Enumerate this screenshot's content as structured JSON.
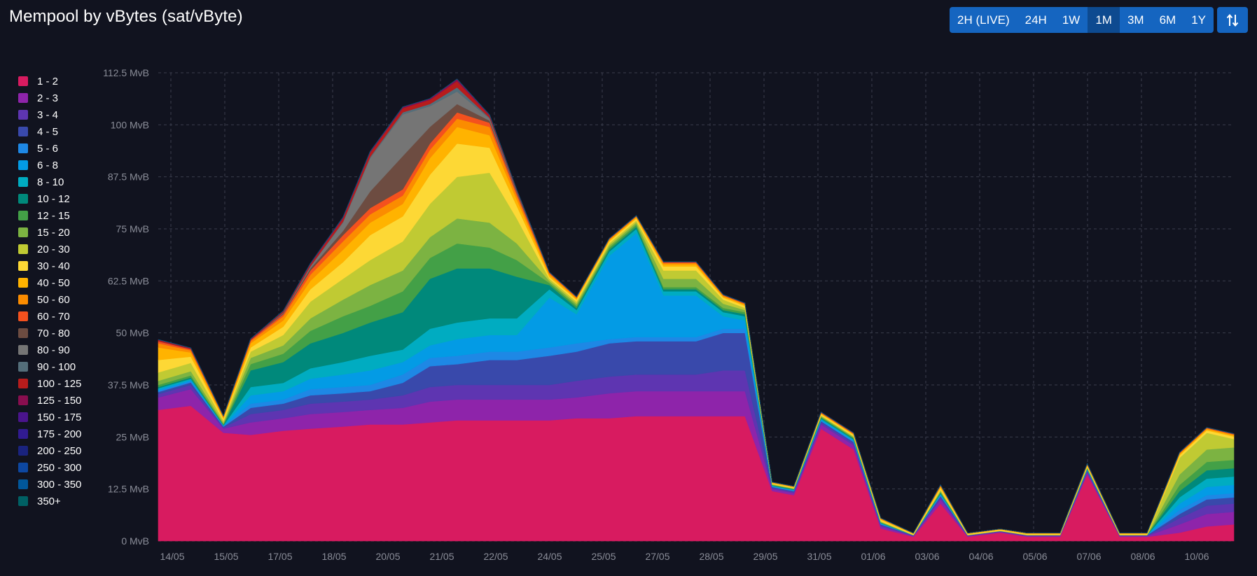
{
  "header": {
    "title": "Mempool by vBytes (sat/vByte)",
    "ranges": [
      "2H (LIVE)",
      "24H",
      "1W",
      "1M",
      "3M",
      "6M",
      "1Y"
    ],
    "active_range": "1M",
    "toggle_icon": "sort-arrows-icon"
  },
  "colors": {
    "background": "#11131f",
    "button": "#1565c0",
    "button_active": "#0d4a90",
    "grid": "#3a3d4c",
    "axis_text": "#8a8d98"
  },
  "chart_data": {
    "type": "area",
    "stacked": true,
    "title": "Mempool by vBytes (sat/vByte)",
    "ylabel_unit": "MvB",
    "ylim": [
      0,
      112.5
    ],
    "yticks": [
      "0 MvB",
      "12.5 MvB",
      "25 MvB",
      "37.5 MvB",
      "50 MvB",
      "62.5 MvB",
      "75 MvB",
      "87.5 MvB",
      "100 MvB",
      "112.5 MvB"
    ],
    "xlim": [
      0,
      30
    ],
    "xticks": [
      {
        "x": 0,
        "label": "14/05"
      },
      {
        "x": 1,
        "label": "15/05"
      },
      {
        "x": 2,
        "label": "17/05"
      },
      {
        "x": 3,
        "label": "18/05"
      },
      {
        "x": 4,
        "label": "20/05"
      },
      {
        "x": 5,
        "label": "21/05"
      },
      {
        "x": 6,
        "label": "22/05"
      },
      {
        "x": 7,
        "label": "24/05"
      },
      {
        "x": 8,
        "label": "25/05"
      },
      {
        "x": 9,
        "label": "27/05"
      },
      {
        "x": 10,
        "label": "28/05"
      },
      {
        "x": 11,
        "label": "29/05"
      },
      {
        "x": 12,
        "label": "31/05"
      },
      {
        "x": 13,
        "label": "01/06"
      },
      {
        "x": 14,
        "label": "03/06"
      },
      {
        "x": 15,
        "label": "04/06"
      },
      {
        "x": 16,
        "label": "05/06"
      },
      {
        "x": 17,
        "label": "07/06"
      },
      {
        "x": 18,
        "label": "08/06"
      },
      {
        "x": 19,
        "label": "10/06"
      }
    ],
    "x": [
      0,
      0.6,
      1.2,
      1.7,
      2.3,
      2.8,
      3.4,
      3.9,
      4.5,
      5.0,
      5.5,
      6.1,
      6.6,
      7.2,
      7.7,
      8.3,
      8.8,
      9.3,
      9.9,
      10.4,
      10.8,
      11.3,
      11.7,
      12.2,
      12.8,
      13.3,
      13.9,
      14.4,
      14.9,
      15.5,
      16.0,
      16.6,
      17.1,
      17.7,
      18.2,
      18.8,
      19.3,
      19.8
    ],
    "series": [
      {
        "name": "1 - 2",
        "color": "#d81b60",
        "values": [
          31.5,
          32.5,
          26,
          25.5,
          26.5,
          27,
          27.5,
          28,
          28,
          28.5,
          29,
          29,
          29,
          29,
          29.5,
          29.5,
          30,
          30,
          30,
          30,
          30,
          12,
          11,
          27,
          22,
          3,
          1,
          9,
          1,
          2,
          1,
          1,
          16,
          1,
          1,
          2,
          3.5,
          4
        ]
      },
      {
        "name": "2 - 3",
        "color": "#8e24aa",
        "values": [
          3,
          4,
          1,
          3,
          3,
          3.5,
          3.5,
          3.5,
          4,
          5,
          5,
          5,
          5,
          5,
          5,
          6,
          6,
          6,
          6,
          6,
          6,
          0.5,
          0.5,
          1,
          1,
          0.5,
          0.2,
          1,
          0.2,
          0.2,
          0.2,
          0.2,
          0.5,
          0.2,
          0.2,
          2,
          3,
          3
        ]
      },
      {
        "name": "3 - 4",
        "color": "#5e35b1",
        "values": [
          0.8,
          1,
          0.3,
          2,
          2,
          2.5,
          2.5,
          2.5,
          3,
          3.5,
          3.5,
          3.5,
          3.5,
          3.5,
          4,
          4,
          4,
          4,
          4,
          5,
          5,
          0.3,
          0.3,
          0.5,
          0.5,
          0.3,
          0.1,
          0.5,
          0.1,
          0.1,
          0.1,
          0.1,
          0.3,
          0.1,
          0.1,
          1.5,
          2,
          2
        ]
      },
      {
        "name": "4 - 5",
        "color": "#3949ab",
        "values": [
          0.5,
          0.6,
          0.2,
          1.5,
          1.5,
          2,
          2,
          2,
          3,
          5,
          5,
          6,
          6,
          7,
          7,
          8,
          8,
          8,
          8,
          9,
          9,
          0.2,
          0.2,
          0.3,
          0.3,
          0.2,
          0.1,
          0.3,
          0.1,
          0.1,
          0.1,
          0.1,
          0.2,
          0.1,
          0.1,
          1,
          1.5,
          1.5
        ]
      },
      {
        "name": "5 - 6",
        "color": "#1e88e5",
        "values": [
          0.3,
          0.3,
          0.1,
          1,
          1,
          1.5,
          1.5,
          1.5,
          2,
          2,
          2,
          2,
          2,
          2,
          2,
          1,
          1,
          1,
          1,
          1,
          1,
          0.1,
          0.1,
          0.2,
          0.2,
          0.1,
          0,
          0.2,
          0,
          0,
          0,
          0,
          0.1,
          0,
          0,
          1,
          1,
          1
        ]
      },
      {
        "name": "6 - 8",
        "color": "#039be5",
        "values": [
          0.3,
          0.3,
          0.1,
          2,
          2,
          2.5,
          3,
          3.5,
          3,
          3,
          4,
          4,
          4,
          12,
          7,
          20,
          25,
          10,
          10,
          3,
          2,
          0.1,
          0.1,
          0.2,
          0.2,
          0.1,
          0,
          0.2,
          0,
          0,
          0,
          0,
          0.1,
          0,
          0,
          1.5,
          2,
          2
        ]
      },
      {
        "name": "8 - 10",
        "color": "#00acc1",
        "values": [
          0.3,
          0.3,
          0.1,
          2,
          2,
          2.5,
          3,
          3.5,
          3,
          4,
          4,
          4,
          4,
          2,
          1,
          1,
          1,
          1,
          1,
          1,
          1,
          0.1,
          0.1,
          0.2,
          0.2,
          0.1,
          0,
          0.2,
          0,
          0,
          0,
          0,
          0.1,
          0,
          0,
          1.5,
          2,
          2
        ]
      },
      {
        "name": "10 - 12",
        "color": "#00897b",
        "values": [
          0.3,
          0.3,
          0.1,
          4,
          5,
          6,
          7,
          8,
          9,
          12,
          13,
          12,
          10,
          1,
          0.5,
          0.5,
          0.5,
          0.5,
          0.5,
          0.5,
          0.5,
          0.1,
          0.1,
          0.2,
          0.2,
          0.1,
          0,
          0.2,
          0,
          0,
          0,
          0,
          0.1,
          0,
          0,
          1.5,
          2,
          2
        ]
      },
      {
        "name": "12 - 15",
        "color": "#43a047",
        "values": [
          0.5,
          0.5,
          0.2,
          1.5,
          2,
          3,
          4,
          4,
          5,
          5,
          6,
          5,
          4,
          0.5,
          0.5,
          0.5,
          0.5,
          0.5,
          0.5,
          0.5,
          0.5,
          0.1,
          0.1,
          0.2,
          0.2,
          0.1,
          0,
          0.2,
          0,
          0,
          0,
          0,
          0.1,
          0,
          0,
          1.5,
          2,
          2
        ]
      },
      {
        "name": "15 - 20",
        "color": "#7cb342",
        "values": [
          1,
          1,
          0.3,
          1.5,
          2,
          3,
          4,
          5,
          5,
          5,
          6,
          6,
          4,
          0.5,
          0.5,
          0.5,
          0.5,
          2,
          2,
          1,
          0.5,
          0.1,
          0.1,
          0.2,
          0.2,
          0.1,
          0,
          0.2,
          0,
          0,
          0,
          0,
          0.1,
          0,
          0,
          2.5,
          3,
          3
        ]
      },
      {
        "name": "20 - 30",
        "color": "#c0ca33",
        "values": [
          2,
          2,
          0.5,
          1.5,
          2.5,
          4,
          5,
          6,
          7,
          8,
          10,
          12,
          6,
          0.5,
          0.5,
          0.5,
          0.5,
          2,
          2,
          1,
          0.5,
          0.1,
          0.1,
          0.2,
          0.2,
          0.2,
          0.1,
          0.3,
          0.1,
          0.1,
          0.1,
          0.1,
          0.2,
          0.1,
          0.1,
          4,
          4,
          2
        ]
      },
      {
        "name": "30 - 40",
        "color": "#fdd835",
        "values": [
          3,
          1.5,
          0.5,
          1,
          2,
          3,
          4,
          6,
          6,
          7,
          8,
          6,
          3,
          0.5,
          0.5,
          0.5,
          0.5,
          1,
          1,
          0.5,
          0.5,
          0.2,
          0.2,
          0.3,
          0.3,
          0.3,
          0.2,
          0.5,
          0.2,
          0.2,
          0.2,
          0.2,
          0.3,
          0.2,
          0.2,
          0.6,
          0.6,
          0.6
        ]
      },
      {
        "name": "40 - 50",
        "color": "#ffb300",
        "values": [
          3,
          1,
          0.3,
          1,
          1.5,
          2,
          3,
          3,
          3,
          4,
          4,
          3,
          1.5,
          0.5,
          0.3,
          0.3,
          0.3,
          0.5,
          0.5,
          0.3,
          0.3,
          0.1,
          0.1,
          0.2,
          0.2,
          0.2,
          0.1,
          0.3,
          0.1,
          0.1,
          0.1,
          0.1,
          0.2,
          0.1,
          0.1,
          0.3,
          0.3,
          0.3
        ]
      },
      {
        "name": "50 - 60",
        "color": "#fb8c00",
        "values": [
          1,
          0.5,
          0.2,
          0.5,
          1,
          1.5,
          2,
          2,
          2,
          2,
          2,
          2,
          1,
          0.3,
          0.2,
          0.2,
          0.2,
          0.3,
          0.3,
          0.2,
          0.2,
          0.1,
          0.1,
          0.1,
          0.1,
          0.1,
          0.1,
          0.2,
          0.1,
          0.1,
          0.1,
          0.1,
          0.1,
          0.1,
          0.1,
          0.2,
          0.2,
          0.2
        ]
      },
      {
        "name": "60 - 70",
        "color": "#f4511e",
        "values": [
          0.5,
          0.3,
          0.1,
          0.3,
          0.5,
          1,
          1.5,
          1.5,
          1.5,
          1.5,
          1.5,
          1,
          0.5,
          0.2,
          0.1,
          0.1,
          0.1,
          0.2,
          0.2,
          0.1,
          0.1,
          0.05,
          0.05,
          0.1,
          0.1,
          0.1,
          0,
          0.1,
          0,
          0,
          0,
          0,
          0.1,
          0,
          0,
          0.1,
          0.1,
          0.1
        ]
      },
      {
        "name": "70 - 80",
        "color": "#6d4c41",
        "values": [
          0,
          0,
          0,
          0,
          0.2,
          0.5,
          1,
          4,
          8,
          4,
          2,
          0.5,
          0.2,
          0,
          0,
          0,
          0,
          0,
          0,
          0,
          0,
          0,
          0,
          0,
          0,
          0,
          0,
          0,
          0,
          0,
          0,
          0,
          0,
          0,
          0,
          0,
          0,
          0
        ]
      },
      {
        "name": "80 - 90",
        "color": "#757575",
        "values": [
          0,
          0,
          0,
          0,
          0.2,
          0.5,
          2,
          8,
          10,
          5,
          3,
          0.5,
          0.2,
          0,
          0,
          0,
          0,
          0,
          0,
          0,
          0,
          0,
          0,
          0,
          0,
          0,
          0,
          0,
          0,
          0,
          0,
          0,
          0,
          0,
          0,
          0,
          0,
          0
        ]
      },
      {
        "name": "90 - 100",
        "color": "#546e7a",
        "values": [
          0,
          0,
          0,
          0,
          0,
          0,
          0.2,
          0.3,
          0.5,
          0.5,
          1,
          0.2,
          0.1,
          0,
          0,
          0,
          0,
          0,
          0,
          0,
          0,
          0,
          0,
          0,
          0,
          0,
          0,
          0,
          0,
          0,
          0,
          0,
          0,
          0,
          0,
          0,
          0,
          0
        ]
      },
      {
        "name": "100 - 125",
        "color": "#b71c1c",
        "values": [
          0.3,
          0.2,
          0.1,
          0.2,
          0.3,
          0.5,
          0.8,
          1,
          1,
          1,
          1.5,
          0.5,
          0.3,
          0.1,
          0.1,
          0.1,
          0.1,
          0.1,
          0.1,
          0.1,
          0.1,
          0,
          0,
          0.1,
          0.1,
          0,
          0,
          0.1,
          0,
          0,
          0,
          0,
          0.1,
          0,
          0,
          0.1,
          0.1,
          0.1
        ]
      },
      {
        "name": "125 - 150",
        "color": "#880e4f",
        "values": [
          0.1,
          0.1,
          0,
          0.1,
          0.1,
          0.2,
          0.3,
          0.3,
          0.3,
          0.3,
          0.5,
          0.2,
          0.1,
          0,
          0,
          0,
          0,
          0,
          0,
          0,
          0,
          0,
          0,
          0,
          0,
          0,
          0,
          0,
          0,
          0,
          0,
          0,
          0,
          0,
          0,
          0,
          0,
          0
        ]
      },
      {
        "name": "150 - 175",
        "color": "#4a148c",
        "values": [
          0,
          0,
          0,
          0,
          0,
          0,
          0,
          0,
          0,
          0,
          0,
          0,
          0,
          0,
          0,
          0,
          0,
          0,
          0,
          0,
          0,
          0,
          0,
          0,
          0,
          0,
          0,
          0,
          0,
          0,
          0,
          0,
          0,
          0,
          0,
          0,
          0,
          0
        ]
      },
      {
        "name": "175 - 200",
        "color": "#311b92",
        "values": [
          0,
          0,
          0,
          0,
          0,
          0,
          0,
          0,
          0,
          0,
          0,
          0,
          0,
          0,
          0,
          0,
          0,
          0,
          0,
          0,
          0,
          0,
          0,
          0,
          0,
          0,
          0,
          0,
          0,
          0,
          0,
          0,
          0,
          0,
          0,
          0,
          0,
          0
        ]
      },
      {
        "name": "200 - 250",
        "color": "#1a237e",
        "values": [
          0,
          0,
          0,
          0,
          0,
          0,
          0,
          0,
          0,
          0,
          0,
          0,
          0,
          0,
          0,
          0,
          0,
          0,
          0,
          0,
          0,
          0,
          0,
          0,
          0,
          0,
          0,
          0,
          0,
          0,
          0,
          0,
          0,
          0,
          0,
          0,
          0,
          0
        ]
      },
      {
        "name": "250 - 300",
        "color": "#0d47a1",
        "values": [
          0,
          0,
          0,
          0,
          0,
          0,
          0,
          0,
          0,
          0,
          0,
          0,
          0,
          0,
          0,
          0,
          0,
          0,
          0,
          0,
          0,
          0,
          0,
          0,
          0,
          0,
          0,
          0,
          0,
          0,
          0,
          0,
          0,
          0,
          0,
          0,
          0,
          0
        ]
      },
      {
        "name": "300 - 350",
        "color": "#01579b",
        "values": [
          0,
          0,
          0,
          0,
          0,
          0,
          0,
          0,
          0,
          0,
          0,
          0,
          0,
          0,
          0,
          0,
          0,
          0,
          0,
          0,
          0,
          0,
          0,
          0,
          0,
          0,
          0,
          0,
          0,
          0,
          0,
          0,
          0,
          0,
          0,
          0,
          0,
          0
        ]
      },
      {
        "name": "350+",
        "color": "#006064",
        "values": [
          0,
          0,
          0,
          0,
          0,
          0,
          0,
          0,
          0,
          0,
          0,
          0,
          0,
          0,
          0,
          0,
          0,
          0,
          0,
          0,
          0,
          0,
          0,
          0,
          0,
          0,
          0,
          0,
          0,
          0,
          0,
          0,
          0,
          0,
          0,
          0,
          0,
          0
        ]
      }
    ],
    "legend_position": "left",
    "grid": true
  }
}
